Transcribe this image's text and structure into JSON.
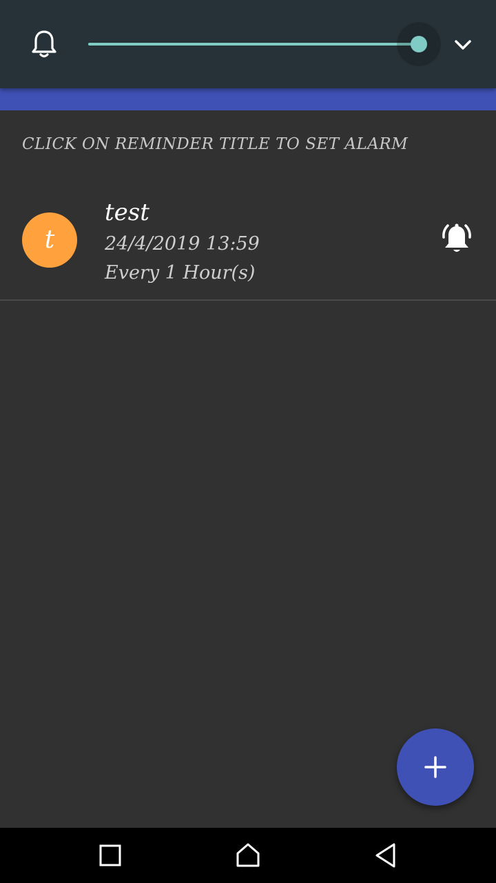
{
  "top_panel": {
    "bell_icon": "bell-outline-icon",
    "slider_value": 1.0,
    "slider_color": "#80cbc4",
    "expand_icon": "chevron-down-icon",
    "background": "#263238"
  },
  "app_bar": {
    "color": "#3f51b5"
  },
  "hint": "CLICK ON REMINDER TITLE TO SET ALARM",
  "reminders": [
    {
      "avatar_letter": "t",
      "avatar_color": "#ffa23d",
      "title": "test",
      "datetime": "24/4/2019 13:59",
      "repeat": "Every 1 Hour(s)",
      "alarm_icon": "alarm-ringing-icon"
    }
  ],
  "fab": {
    "icon": "plus-icon",
    "color": "#3f51b5"
  },
  "nav": {
    "recents_icon": "square-recents-icon",
    "home_icon": "home-icon",
    "back_icon": "triangle-back-icon"
  }
}
